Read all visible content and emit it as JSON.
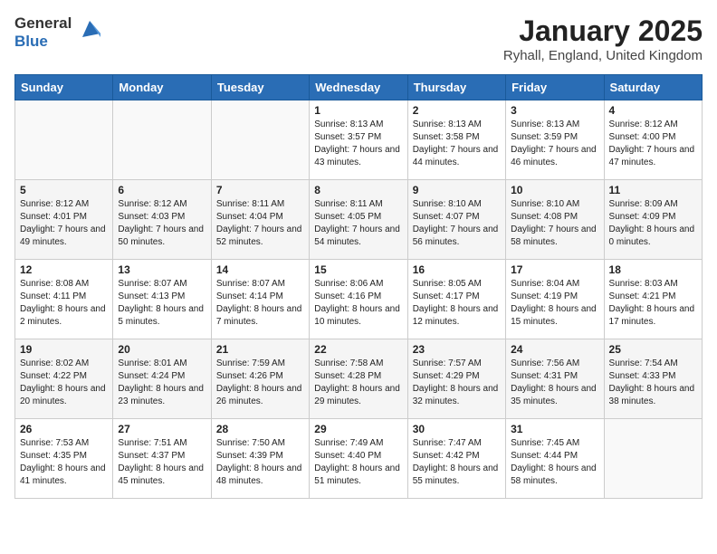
{
  "header": {
    "logo_general": "General",
    "logo_blue": "Blue",
    "month_title": "January 2025",
    "location": "Ryhall, England, United Kingdom"
  },
  "weekdays": [
    "Sunday",
    "Monday",
    "Tuesday",
    "Wednesday",
    "Thursday",
    "Friday",
    "Saturday"
  ],
  "weeks": [
    [
      {
        "day": "",
        "info": ""
      },
      {
        "day": "",
        "info": ""
      },
      {
        "day": "",
        "info": ""
      },
      {
        "day": "1",
        "info": "Sunrise: 8:13 AM\nSunset: 3:57 PM\nDaylight: 7 hours and 43 minutes."
      },
      {
        "day": "2",
        "info": "Sunrise: 8:13 AM\nSunset: 3:58 PM\nDaylight: 7 hours and 44 minutes."
      },
      {
        "day": "3",
        "info": "Sunrise: 8:13 AM\nSunset: 3:59 PM\nDaylight: 7 hours and 46 minutes."
      },
      {
        "day": "4",
        "info": "Sunrise: 8:12 AM\nSunset: 4:00 PM\nDaylight: 7 hours and 47 minutes."
      }
    ],
    [
      {
        "day": "5",
        "info": "Sunrise: 8:12 AM\nSunset: 4:01 PM\nDaylight: 7 hours and 49 minutes."
      },
      {
        "day": "6",
        "info": "Sunrise: 8:12 AM\nSunset: 4:03 PM\nDaylight: 7 hours and 50 minutes."
      },
      {
        "day": "7",
        "info": "Sunrise: 8:11 AM\nSunset: 4:04 PM\nDaylight: 7 hours and 52 minutes."
      },
      {
        "day": "8",
        "info": "Sunrise: 8:11 AM\nSunset: 4:05 PM\nDaylight: 7 hours and 54 minutes."
      },
      {
        "day": "9",
        "info": "Sunrise: 8:10 AM\nSunset: 4:07 PM\nDaylight: 7 hours and 56 minutes."
      },
      {
        "day": "10",
        "info": "Sunrise: 8:10 AM\nSunset: 4:08 PM\nDaylight: 7 hours and 58 minutes."
      },
      {
        "day": "11",
        "info": "Sunrise: 8:09 AM\nSunset: 4:09 PM\nDaylight: 8 hours and 0 minutes."
      }
    ],
    [
      {
        "day": "12",
        "info": "Sunrise: 8:08 AM\nSunset: 4:11 PM\nDaylight: 8 hours and 2 minutes."
      },
      {
        "day": "13",
        "info": "Sunrise: 8:07 AM\nSunset: 4:13 PM\nDaylight: 8 hours and 5 minutes."
      },
      {
        "day": "14",
        "info": "Sunrise: 8:07 AM\nSunset: 4:14 PM\nDaylight: 8 hours and 7 minutes."
      },
      {
        "day": "15",
        "info": "Sunrise: 8:06 AM\nSunset: 4:16 PM\nDaylight: 8 hours and 10 minutes."
      },
      {
        "day": "16",
        "info": "Sunrise: 8:05 AM\nSunset: 4:17 PM\nDaylight: 8 hours and 12 minutes."
      },
      {
        "day": "17",
        "info": "Sunrise: 8:04 AM\nSunset: 4:19 PM\nDaylight: 8 hours and 15 minutes."
      },
      {
        "day": "18",
        "info": "Sunrise: 8:03 AM\nSunset: 4:21 PM\nDaylight: 8 hours and 17 minutes."
      }
    ],
    [
      {
        "day": "19",
        "info": "Sunrise: 8:02 AM\nSunset: 4:22 PM\nDaylight: 8 hours and 20 minutes."
      },
      {
        "day": "20",
        "info": "Sunrise: 8:01 AM\nSunset: 4:24 PM\nDaylight: 8 hours and 23 minutes."
      },
      {
        "day": "21",
        "info": "Sunrise: 7:59 AM\nSunset: 4:26 PM\nDaylight: 8 hours and 26 minutes."
      },
      {
        "day": "22",
        "info": "Sunrise: 7:58 AM\nSunset: 4:28 PM\nDaylight: 8 hours and 29 minutes."
      },
      {
        "day": "23",
        "info": "Sunrise: 7:57 AM\nSunset: 4:29 PM\nDaylight: 8 hours and 32 minutes."
      },
      {
        "day": "24",
        "info": "Sunrise: 7:56 AM\nSunset: 4:31 PM\nDaylight: 8 hours and 35 minutes."
      },
      {
        "day": "25",
        "info": "Sunrise: 7:54 AM\nSunset: 4:33 PM\nDaylight: 8 hours and 38 minutes."
      }
    ],
    [
      {
        "day": "26",
        "info": "Sunrise: 7:53 AM\nSunset: 4:35 PM\nDaylight: 8 hours and 41 minutes."
      },
      {
        "day": "27",
        "info": "Sunrise: 7:51 AM\nSunset: 4:37 PM\nDaylight: 8 hours and 45 minutes."
      },
      {
        "day": "28",
        "info": "Sunrise: 7:50 AM\nSunset: 4:39 PM\nDaylight: 8 hours and 48 minutes."
      },
      {
        "day": "29",
        "info": "Sunrise: 7:49 AM\nSunset: 4:40 PM\nDaylight: 8 hours and 51 minutes."
      },
      {
        "day": "30",
        "info": "Sunrise: 7:47 AM\nSunset: 4:42 PM\nDaylight: 8 hours and 55 minutes."
      },
      {
        "day": "31",
        "info": "Sunrise: 7:45 AM\nSunset: 4:44 PM\nDaylight: 8 hours and 58 minutes."
      },
      {
        "day": "",
        "info": ""
      }
    ]
  ]
}
